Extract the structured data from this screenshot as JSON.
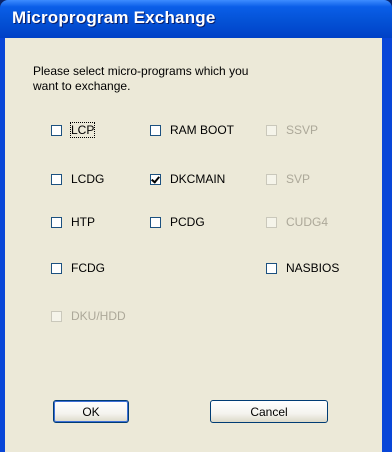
{
  "window": {
    "title": "Microprogram Exchange"
  },
  "dialog": {
    "instructions": "Please select micro-programs which you\nwant to exchange."
  },
  "checkboxes": {
    "lcp": {
      "label": "LCP",
      "checked": false,
      "enabled": true
    },
    "ram_boot": {
      "label": "RAM BOOT",
      "checked": false,
      "enabled": true
    },
    "ssvp": {
      "label": "SSVP",
      "checked": false,
      "enabled": false
    },
    "lcdg": {
      "label": "LCDG",
      "checked": false,
      "enabled": true
    },
    "dkcmain": {
      "label": "DKCMAIN",
      "checked": true,
      "enabled": true
    },
    "svp": {
      "label": "SVP",
      "checked": false,
      "enabled": false
    },
    "htp": {
      "label": "HTP",
      "checked": false,
      "enabled": true
    },
    "pcdg": {
      "label": "PCDG",
      "checked": false,
      "enabled": true
    },
    "cudg4": {
      "label": "CUDG4",
      "checked": false,
      "enabled": false
    },
    "fcdg": {
      "label": "FCDG",
      "checked": false,
      "enabled": true
    },
    "nasbios": {
      "label": "NASBIOS",
      "checked": false,
      "enabled": true
    },
    "dku_hdd": {
      "label": "DKU/HDD",
      "checked": false,
      "enabled": false
    }
  },
  "buttons": {
    "ok_label": "OK",
    "cancel_label": "Cancel"
  },
  "colors": {
    "title_bar": "#0452d6",
    "dialog_face": "#ece9d8",
    "disabled_text": "#aca899"
  }
}
